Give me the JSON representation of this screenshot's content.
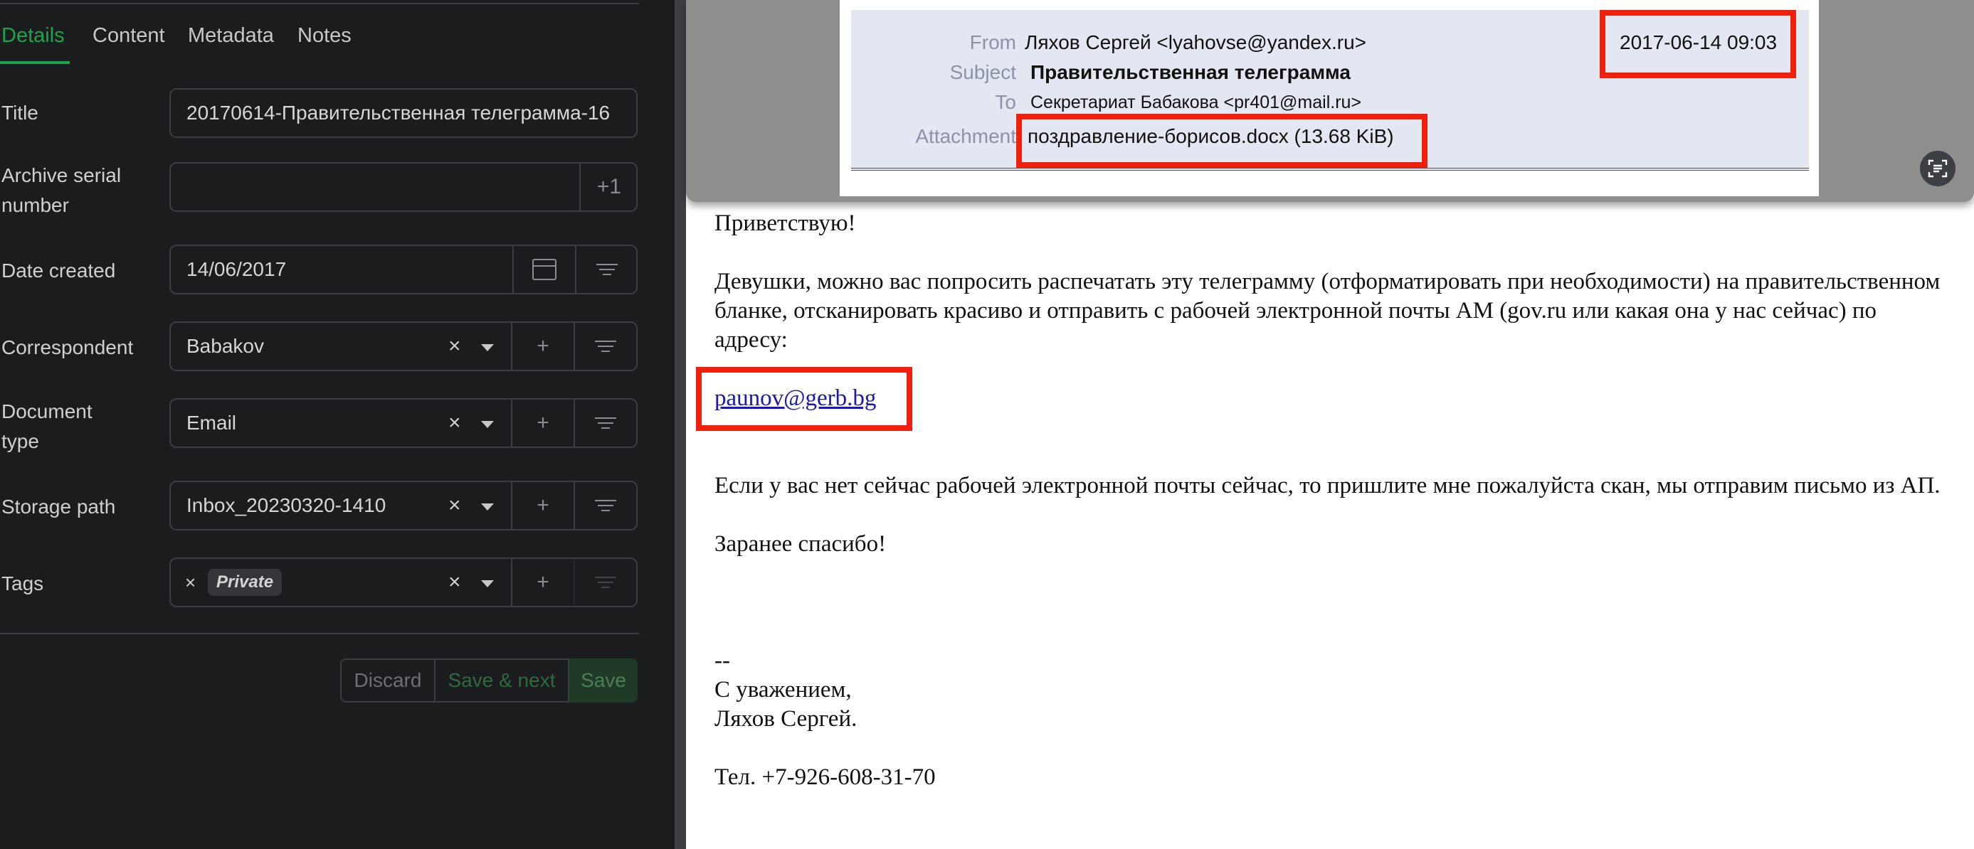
{
  "tabs": [
    "Details",
    "Content",
    "Metadata",
    "Notes"
  ],
  "fields": {
    "title": {
      "label": "Title",
      "value": "20170614-Правительственная телеграмма-16"
    },
    "asn": {
      "label_line1": "Archive serial",
      "label_line2": "number",
      "value": "",
      "plus": "+1"
    },
    "date": {
      "label": "Date created",
      "value": "14/06/2017"
    },
    "correspondent": {
      "label": "Correspondent",
      "value": "Babakov"
    },
    "doctype": {
      "label_line1": "Document",
      "label_line2": "type",
      "value": "Email"
    },
    "storage": {
      "label": "Storage path",
      "value": "Inbox_20230320-1410"
    },
    "tags": {
      "label": "Tags",
      "tag": "Private"
    }
  },
  "icons": {
    "clear": "×",
    "add": "+",
    "remove_tag": "×"
  },
  "buttons": {
    "discard": "Discard",
    "save_next": "Save & next",
    "save": "Save"
  },
  "email_header": {
    "from_label": "From",
    "from_value": "Ляхов Сергей <lyahovse@yandex.ru>",
    "date": "2017-06-14 09:03",
    "subject_label": "Subject",
    "subject_value": "Правительственная телеграмма",
    "to_label": "To",
    "to_value": "Секретариат Бабакова <pr401@mail.ru>",
    "attachment_label": "Attachment",
    "attachment_value": "поздравление-борисов.docx (13.68 KiB)"
  },
  "email_body": {
    "greeting": "Приветствую!",
    "para1": "Девушки, можно вас попросить распечатать эту телеграмму (отформатировать при необходимости) на правительственном бланке, отсканировать красиво и отправить с рабочей электронной почты АМ (gov.ru или какая она у нас сейчас) по адресу:",
    "link": "paunov@gerb.bg",
    "para2": "Если у вас нет сейчас рабочей электронной почты сейчас, то пришлите мне пожалуйста скан, мы отправим письмо из АП.",
    "thanks": "Заранее спасибо!",
    "sig_sep": "--",
    "sig1": "С уважением,",
    "sig2": "Ляхов Сергей.",
    "phone": "Тел. +7-926-608-31-70"
  },
  "colors": {
    "accent_green": "#1fa34a",
    "highlight_red": "#f0200c"
  }
}
